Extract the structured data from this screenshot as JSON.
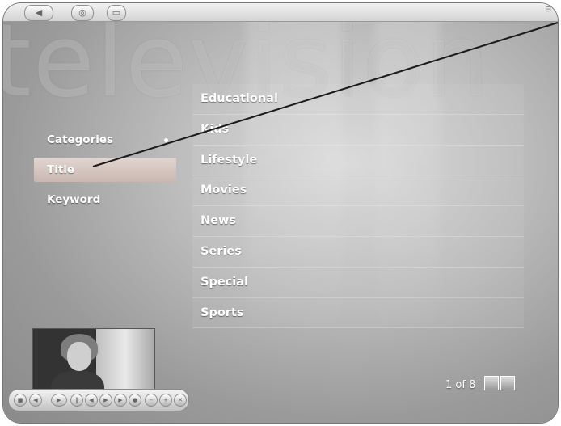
{
  "background": {
    "watermark": "television"
  },
  "left_menu": {
    "items": [
      {
        "label": "Categories"
      },
      {
        "label": "Title"
      },
      {
        "label": "Keyword"
      }
    ],
    "selected": "Title"
  },
  "categories": {
    "items": [
      {
        "label": "Educational"
      },
      {
        "label": "Kids"
      },
      {
        "label": "Lifestyle"
      },
      {
        "label": "Movies"
      },
      {
        "label": "News"
      },
      {
        "label": "Series"
      },
      {
        "label": "Special"
      },
      {
        "label": "Sports"
      }
    ]
  },
  "pager": {
    "text": "1 of 8"
  },
  "icons": {
    "topbar": [
      "back-icon",
      "windows-logo-icon",
      "small-window-icon"
    ],
    "transport": [
      "stop-icon",
      "rewind-icon",
      "play-icon",
      "pause-icon",
      "skip-back-icon",
      "fast-forward-icon",
      "skip-forward-icon",
      "record-icon",
      "volume-down-icon",
      "volume-up-icon",
      "mute-icon"
    ]
  },
  "colors": {
    "text": "#ffffff",
    "selected_bg": "#d6c8c1"
  }
}
